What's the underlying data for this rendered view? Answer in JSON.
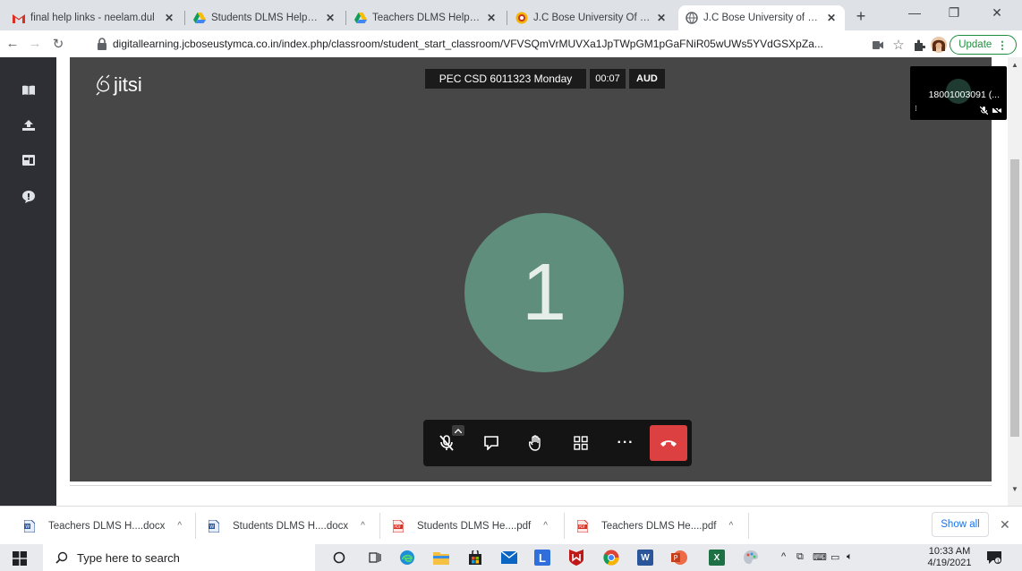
{
  "browser": {
    "tabs": [
      {
        "title": "final help links - neelam.dul",
        "icon": "gmail-icon",
        "active": false
      },
      {
        "title": "Students DLMS Help Book.p",
        "icon": "drive-icon",
        "active": false
      },
      {
        "title": "Teachers DLMS Help Book",
        "icon": "drive-icon",
        "active": false
      },
      {
        "title": "J.C Bose University Of Scien",
        "icon": "site-icon",
        "active": false
      },
      {
        "title": "J.C Bose University of Scien",
        "icon": "globe-icon",
        "active": true
      }
    ],
    "new_tab": "+",
    "window_controls": {
      "minimize": "—",
      "restore": "❐",
      "close": "✕"
    },
    "url": "digitallearning.jcboseustymca.co.in/index.php/classroom/student_start_classroom/VFVSQmVrMUVXa1JpTWpGM1pGaFNiR05wUWs5YVdGSXpZa...",
    "update_label": "Update"
  },
  "meeting": {
    "logo_text": "jitsi",
    "room_name": "PEC CSD 6011323 Monday",
    "elapsed": "00:07",
    "badge": "AUD",
    "big_avatar": "1",
    "thumbnail_name": "18001003091 (...",
    "colors": {
      "stage": "#474747",
      "avatar": "#5f8e7c",
      "hangup": "#dd4040"
    }
  },
  "downloads": {
    "items": [
      {
        "name": "Teachers DLMS H....docx",
        "type": "docx"
      },
      {
        "name": "Students DLMS H....docx",
        "type": "docx"
      },
      {
        "name": "Students DLMS He....pdf",
        "type": "pdf"
      },
      {
        "name": "Teachers DLMS He....pdf",
        "type": "pdf"
      }
    ],
    "show_all": "Show all"
  },
  "taskbar": {
    "search_placeholder": "Type here to search",
    "time": "10:33 AM",
    "date": "4/19/2021"
  }
}
